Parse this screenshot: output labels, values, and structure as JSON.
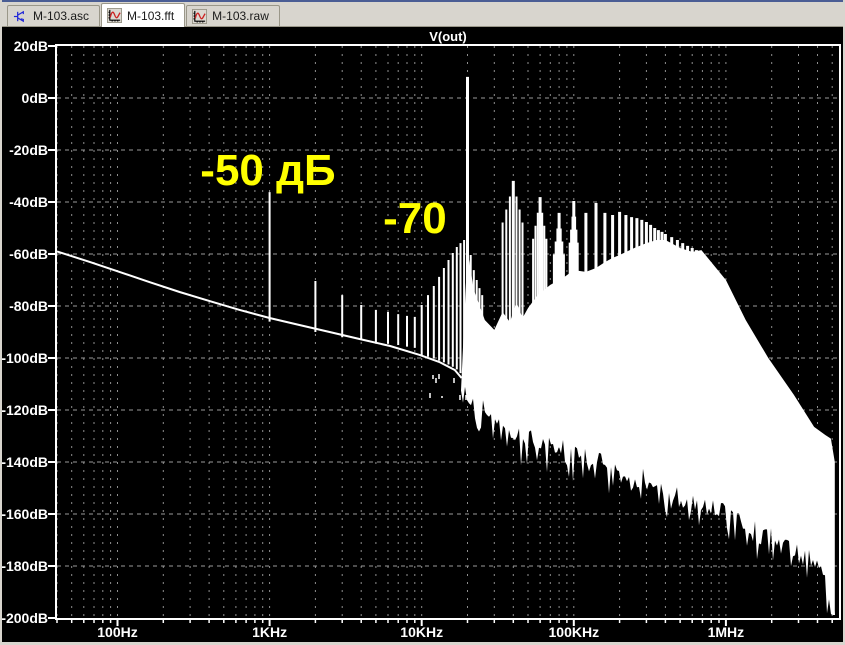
{
  "window": {
    "tabs": [
      {
        "label": "M-103.asc",
        "icon": "schematic-icon",
        "active": false
      },
      {
        "label": "M-103.fft",
        "icon": "waveform-icon",
        "active": true
      },
      {
        "label": "M-103.raw",
        "icon": "waveform-icon",
        "active": false
      }
    ]
  },
  "chart_data": {
    "type": "line",
    "title": "V(out)",
    "x_axis": {
      "scale": "log",
      "unit": "Hz",
      "range": [
        40,
        5540000
      ],
      "tick_values": [
        100,
        1000,
        10000,
        100000,
        1000000
      ],
      "tick_labels": [
        "100Hz",
        "1KHz",
        "10KHz",
        "100KHz",
        "1MHz"
      ]
    },
    "y_axis": {
      "unit": "dB",
      "range": [
        -200,
        20
      ],
      "tick_step": 20,
      "tick_values": [
        20,
        0,
        -20,
        -40,
        -60,
        -80,
        -100,
        -120,
        -140,
        -160,
        -180,
        -200
      ],
      "tick_labels": [
        "20dB",
        "0dB",
        "-20dB",
        "-40dB",
        "-60dB",
        "-80dB",
        "-100dB",
        "-120dB",
        "-140dB",
        "-160dB",
        "-180dB",
        "-200dB"
      ]
    },
    "grid": true,
    "legend": "none",
    "colors": {
      "trace": "#ffffff",
      "background": "#000000",
      "grid": "#8f8f8f",
      "annotation": "#ffff00"
    },
    "annotations": [
      {
        "text": "-50 дБ",
        "f": 350,
        "db": -33.5,
        "color": "#ffff00"
      },
      {
        "text": "-70",
        "f": 5570,
        "db": -51.9,
        "color": "#ffff00"
      }
    ],
    "series": [
      {
        "name": "V(out)",
        "color": "#ffffff",
        "noise_floor": [
          [
            40,
            -59
          ],
          [
            66,
            -63.1
          ],
          [
            103,
            -66.9
          ],
          [
            162,
            -70.8
          ],
          [
            256,
            -74.6
          ],
          [
            403,
            -78.1
          ],
          [
            635,
            -81.5
          ],
          [
            1000,
            -84.6
          ],
          [
            1570,
            -87.3
          ],
          [
            2480,
            -90
          ],
          [
            3900,
            -92.7
          ],
          [
            6200,
            -95.4
          ],
          [
            9700,
            -98.8
          ],
          [
            13000,
            -101.5
          ],
          [
            16500,
            -104.6
          ],
          [
            18300,
            -107.7
          ]
        ],
        "spikes": [
          [
            1000,
            -36.2,
            -86
          ],
          [
            2000,
            -70.4,
            -90
          ],
          [
            3000,
            -75.8,
            -92
          ],
          [
            4000,
            -79.6,
            -93
          ],
          [
            5000,
            -81.5,
            -94
          ],
          [
            6000,
            -82.3,
            -94.5
          ],
          [
            7000,
            -83.1,
            -95
          ],
          [
            8000,
            -83.8,
            -95.6
          ],
          [
            9000,
            -84.2,
            -96.1
          ],
          [
            10000,
            -79.6,
            -99
          ],
          [
            11000,
            -75.8,
            -99.5
          ],
          [
            12000,
            -72.3,
            -100.2
          ],
          [
            13000,
            -68.8,
            -101
          ],
          [
            14000,
            -65.4,
            -101.7
          ],
          [
            15000,
            -62.3,
            -102.5
          ],
          [
            16000,
            -59.6,
            -103.4
          ],
          [
            17000,
            -57.3,
            -104.4
          ],
          [
            18000,
            -55.8,
            -105.8
          ],
          [
            19000,
            -54.6,
            -107.5
          ],
          [
            21000,
            -60.4,
            -75
          ],
          [
            22000,
            -66.2,
            -78
          ],
          [
            23000,
            -70,
            -81
          ],
          [
            24000,
            -73.1,
            -84
          ],
          [
            25000,
            -75.8,
            -86
          ]
        ],
        "main_spike": [
          20000,
          8.1,
          -76
        ],
        "comb": [
          [
            40000,
            -31.9
          ],
          [
            60000,
            -38.1
          ],
          [
            80000,
            -44.2
          ],
          [
            100000,
            -39.6
          ],
          [
            120000,
            -44.2
          ],
          [
            140000,
            -40.4
          ],
          [
            160000,
            -44.2
          ],
          [
            180000,
            -45
          ],
          [
            200000,
            -43.8
          ],
          [
            220000,
            -45
          ],
          [
            240000,
            -45.8
          ],
          [
            260000,
            -46.2
          ],
          [
            280000,
            -46.9
          ],
          [
            300000,
            -47.7
          ],
          [
            320000,
            -48.8
          ],
          [
            340000,
            -50
          ],
          [
            360000,
            -50.8
          ],
          [
            380000,
            -51.5
          ],
          [
            400000,
            -52.3
          ],
          [
            440000,
            -53.5
          ],
          [
            480000,
            -54.6
          ],
          [
            520000,
            -55.8
          ],
          [
            560000,
            -56.9
          ],
          [
            600000,
            -57.7
          ],
          [
            640000,
            -58.5
          ],
          [
            680000,
            -59.2
          ]
        ],
        "sideband_offsets": [
          2000,
          4000,
          6000
        ],
        "sideband_drop_db": [
          6,
          11,
          16
        ],
        "envelope_top": [
          [
            20000,
            -58.5
          ],
          [
            22000,
            -73.8
          ],
          [
            26000,
            -85.4
          ],
          [
            30000,
            -89.2
          ],
          [
            34000,
            -82.3
          ],
          [
            38000,
            -86.2
          ],
          [
            42000,
            -78.5
          ],
          [
            46000,
            -84.6
          ],
          [
            50000,
            -80.8
          ],
          [
            56000,
            -76.9
          ],
          [
            60000,
            -75
          ],
          [
            70000,
            -71.9
          ],
          [
            85000,
            -69.2
          ],
          [
            100000,
            -66.2
          ],
          [
            120000,
            -66.9
          ],
          [
            140000,
            -65.4
          ],
          [
            160000,
            -63.1
          ],
          [
            180000,
            -61.5
          ],
          [
            200000,
            -60.4
          ],
          [
            250000,
            -57.7
          ],
          [
            300000,
            -55.8
          ],
          [
            350000,
            -54.6
          ],
          [
            400000,
            -54.6
          ],
          [
            450000,
            -56.2
          ],
          [
            500000,
            -57.7
          ],
          [
            600000,
            -59.2
          ],
          [
            690000,
            -58.5
          ],
          [
            1000000,
            -70
          ],
          [
            1350000,
            -85.4
          ],
          [
            1900000,
            -100
          ],
          [
            2800000,
            -114.2
          ],
          [
            3800000,
            -126.5
          ],
          [
            4500000,
            -129.6
          ],
          [
            4900000,
            -131
          ],
          [
            5200000,
            -140
          ]
        ],
        "envelope_bottom": [
          [
            17800,
            -112
          ],
          [
            20700,
            -116.2
          ],
          [
            24000,
            -119.2
          ],
          [
            28000,
            -120.8
          ],
          [
            32600,
            -123.8
          ],
          [
            38000,
            -128.5
          ],
          [
            44200,
            -130.8
          ],
          [
            59700,
            -133.1
          ],
          [
            80700,
            -135.4
          ],
          [
            109000,
            -137.7
          ],
          [
            147500,
            -140.4
          ],
          [
            199000,
            -143.1
          ],
          [
            269000,
            -146.2
          ],
          [
            363000,
            -149.6
          ],
          [
            491000,
            -152.7
          ],
          [
            663000,
            -155.8
          ],
          [
            896000,
            -159.2
          ],
          [
            1210000,
            -163.1
          ],
          [
            1630000,
            -167.3
          ],
          [
            2210000,
            -171.2
          ],
          [
            2980000,
            -175.4
          ],
          [
            3750000,
            -178.5
          ],
          [
            4400000,
            -185.4
          ],
          [
            4900000,
            -195
          ],
          [
            5200000,
            -197
          ]
        ]
      }
    ]
  }
}
